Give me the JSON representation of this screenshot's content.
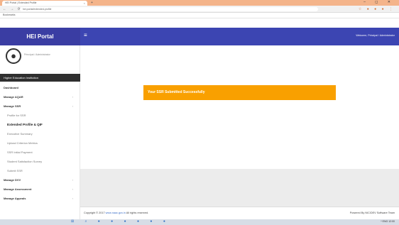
{
  "browser": {
    "tab_title": "HEI Portal | Extended Profile",
    "tab_close": "×",
    "new_tab": "+",
    "window_controls": "– ◻ ✕",
    "nav_icons": "← → ⟳ ⌂",
    "url": "hei.portal/extended-profile",
    "extension_icons": "☆ ● ● ● ⋮",
    "bookmark": "Bookmarks"
  },
  "header": {
    "brand": "HEI Portal",
    "menu_icon": "≡",
    "user_label": "Welcome, Principal / Administrator"
  },
  "sidebar": {
    "avatar_icon": "user-avatar-icon",
    "user_name": "Principal / Administrator",
    "section_title": "Higher Education Institution",
    "items": [
      {
        "label": "Dashboard",
        "chevron": ""
      },
      {
        "label": "Manage AQAR",
        "chevron": "‹"
      },
      {
        "label": "Manage SSR",
        "chevron": "‹"
      },
      {
        "label": "Profile for SSR",
        "chevron": ""
      },
      {
        "label": "Extended Profile & QIF",
        "chevron": ""
      },
      {
        "label": "Executive Summary",
        "chevron": ""
      },
      {
        "label": "Upload Criterion Metrics",
        "chevron": ""
      },
      {
        "label": "SSR Initial Payment",
        "chevron": ""
      },
      {
        "label": "Student Satisfaction Survey",
        "chevron": ""
      },
      {
        "label": "Submit SSR",
        "chevron": ""
      },
      {
        "label": "Manage DVV",
        "chevron": "‹"
      },
      {
        "label": "Manage Assessment",
        "chevron": "‹"
      },
      {
        "label": "Manage Appeals",
        "chevron": "‹"
      }
    ]
  },
  "main": {
    "alert": "Your SSR Submitted Successfully"
  },
  "footer": {
    "copyright": "Copyright © 2017",
    "link": "www.naac.gov.in",
    "rights": "All rights reserved.",
    "powered": "Powered By NIC/DEV Software Team"
  },
  "taskbar": {
    "icons": "⊞ ⌕ ● ● ● ● ● ●",
    "tray": "^ ENG 12:00"
  }
}
